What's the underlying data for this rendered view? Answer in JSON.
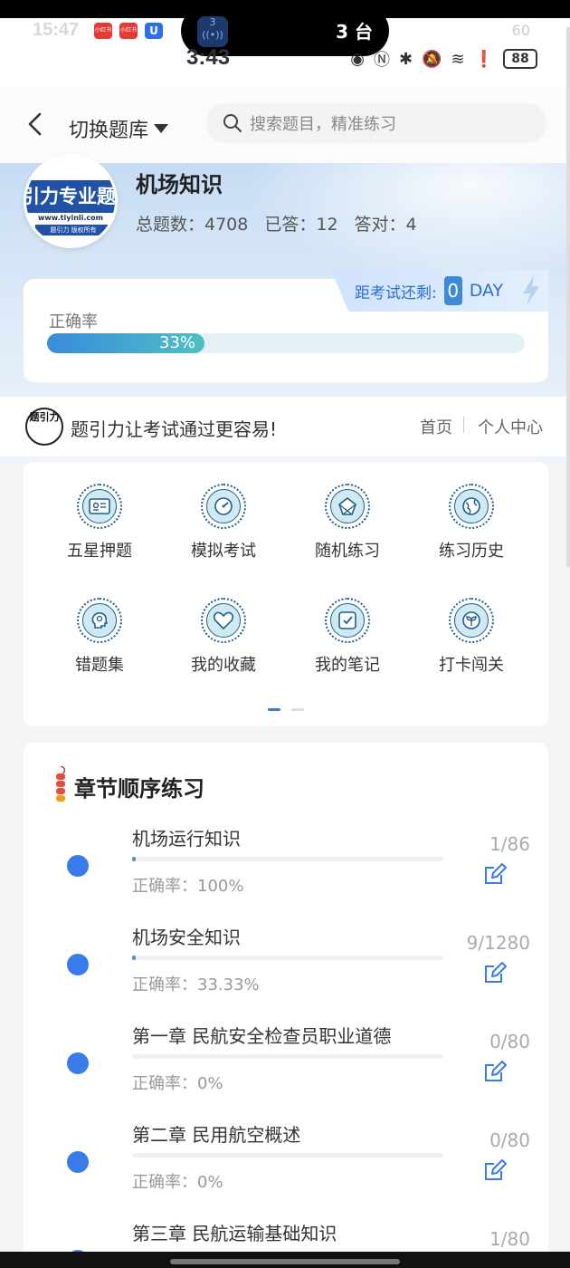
{
  "status_bar": {
    "time": "3:43",
    "time_overlay": "15:47",
    "island_text": "3 台",
    "island_icon_label": "3",
    "battery": "88",
    "signal_back": "60",
    "app_badges": [
      "小红书",
      "小红书",
      "U"
    ]
  },
  "header": {
    "switch_label": "切换题库",
    "search_placeholder": "搜索题目，精准练习"
  },
  "subject": {
    "title": "机场知识",
    "total_label": "总题数：4708",
    "answered_label": "已答：12",
    "correct_label": "答对：4",
    "logo_text": "引力专业题",
    "logo_url": "www.tiyinli.com",
    "logo_footer": "题引力 版权所有"
  },
  "countdown": {
    "label": "距考试还剩:",
    "days": "0",
    "unit": "DAY"
  },
  "accuracy": {
    "label": "正确率",
    "value_text": "33%",
    "fraction": 0.33
  },
  "slogan": {
    "logo_text": "题引力",
    "text": "题引力让考试通过更容易!",
    "nav_home": "首页",
    "nav_center": "个人中心"
  },
  "functions": [
    {
      "label": "五星押题",
      "icon": "id-card-icon"
    },
    {
      "label": "模拟考试",
      "icon": "gauge-icon"
    },
    {
      "label": "随机练习",
      "icon": "random-icon"
    },
    {
      "label": "练习历史",
      "icon": "globe-icon"
    },
    {
      "label": "错题集",
      "icon": "head-icon"
    },
    {
      "label": "我的收藏",
      "icon": "heart-icon"
    },
    {
      "label": "我的笔记",
      "icon": "note-icon"
    },
    {
      "label": "打卡闯关",
      "icon": "sprout-icon"
    }
  ],
  "chapters": {
    "title": "章节顺序练习",
    "items": [
      {
        "name": "机场运行知识",
        "accuracy": "正确率：100%",
        "count": "1/86",
        "progress": 0.012
      },
      {
        "name": "机场安全知识",
        "accuracy": "正确率：33.33%",
        "count": "9/1280",
        "progress": 0.007
      },
      {
        "name": "第一章 民航安全检查员职业道德",
        "accuracy": "正确率：0%",
        "count": "0/80",
        "progress": 0
      },
      {
        "name": "第二章 民用航空概述",
        "accuracy": "正确率：0%",
        "count": "0/80",
        "progress": 0
      },
      {
        "name": "第三章 民航运输基础知识",
        "accuracy": "",
        "count": "1/80",
        "progress": 0.0125
      }
    ]
  },
  "colors": {
    "accent": "#3a7bea",
    "progress_start": "#3a8bdc",
    "progress_end": "#4fbfc2",
    "countdown_text": "#2d6fcf"
  }
}
